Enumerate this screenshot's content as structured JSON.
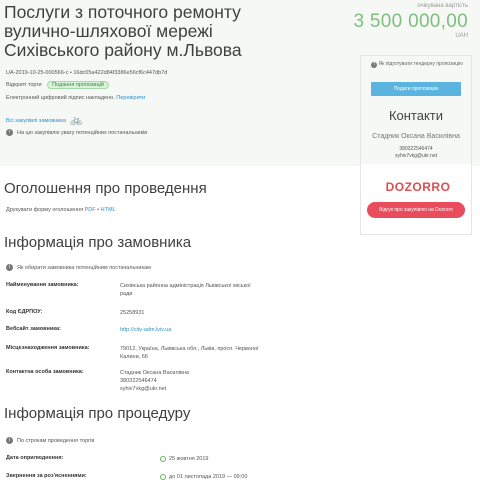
{
  "header": {
    "title": "Послуги з поточного ремонту вулично-шляхової мережі Сихівського району м.Львова",
    "price_caption": "очікувана вартість",
    "price": "3 500 000,00",
    "currency": "UAH",
    "tender_id": "UA-2019-10-25-000566-c",
    "tender_hash": "• 16dc05a422d84f3386e56cf6c447db7d",
    "procedure": "Відкриті торги",
    "status_badge": "Подання пропозицій",
    "signature_text": "Електронний цифровий підпис накладено.",
    "verify_link": "Перевірити",
    "all_purchases_link": "Всі закупівлі замовника",
    "not_qualified_note": "На цю закупівлю увагу потенційних постачальників"
  },
  "card": {
    "not_prepared_note": "Як підготувати тендерну пропозицію",
    "submit_button": "Подати пропозицію",
    "contacts_title": "Контакти",
    "contact_name": "Стадник Оксана Василівна",
    "contact_phone": "380322546474",
    "contact_email": "syhiv7vkg@ukr.net",
    "logo": "DOZORRO",
    "feedback_button": "Відгук про закупівлю на Dozorro"
  },
  "notice": {
    "title": "Оголошення про проведення",
    "print_prefix": "Друкувати форму оголошення",
    "pdf": "PDF",
    "sep": "•",
    "html": "HTML"
  },
  "customer": {
    "title": "Інформація про замовника",
    "note": "Як обирати замовника потенційним постачальникам",
    "rows": [
      {
        "label": "Найменування замовника:",
        "value": "Сихівська районна адміністрація Львівської міської ради"
      },
      {
        "label": "Код ЄДРПОУ:",
        "value": "25258931"
      },
      {
        "label": "Вебсайт замовника:",
        "value": "http://city-adm.lviv.ua"
      },
      {
        "label": "Місцезнаходження замовника:",
        "value": "79012, Україна, Львівська обл., Львів, просп. Червоної Калини, 66"
      },
      {
        "label": "Контактна особа замовника:",
        "value": "Стадник Оксана Василівна 380322546474 syhiv7vkg@ukr.net"
      }
    ]
  },
  "procedure": {
    "title": "Інформація про процедуру",
    "note": "По строкам проведення торгів",
    "rows": [
      {
        "label": "Дата оприлюднення:",
        "value": "25 жовтня 2019"
      },
      {
        "label": "Звернення за роз'ясненнями:",
        "value": "до  01 листопада 2019 — 09:00"
      }
    ]
  }
}
